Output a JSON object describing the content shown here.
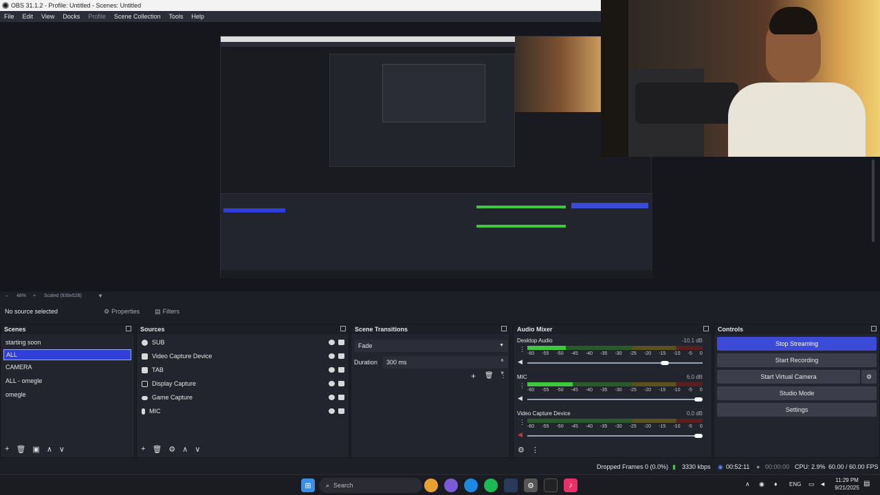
{
  "window": {
    "title": "OBS 31.1.2 - Profile: Untitled - Scenes: Untitled"
  },
  "menu": {
    "items": [
      "File",
      "Edit",
      "View",
      "Docks",
      "Profile",
      "Scene Collection",
      "Tools",
      "Help"
    ]
  },
  "zoom": {
    "percent": "48%",
    "scaled": "Scaled (939x528)"
  },
  "selection": {
    "status": "No source selected",
    "properties_label": "Properties",
    "filters_label": "Filters"
  },
  "scenes": {
    "title": "Scenes",
    "items": [
      "starting soon",
      "ALL",
      "CAMERA",
      "ALL - omegle",
      "omegle"
    ],
    "selected": "ALL"
  },
  "sources": {
    "title": "Sources",
    "items": [
      {
        "label": "SUB",
        "icon": "browser-icon"
      },
      {
        "label": "Video Capture Device",
        "icon": "camera-icon"
      },
      {
        "label": "TAB",
        "icon": "window-icon"
      },
      {
        "label": "Display Capture",
        "icon": "monitor-icon"
      },
      {
        "label": "Game Capture",
        "icon": "gamepad-icon"
      },
      {
        "label": "MIC",
        "icon": "microphone-icon"
      }
    ]
  },
  "transitions": {
    "title": "Scene Transitions",
    "type": "Fade",
    "duration_label": "Duration",
    "duration_value": "300 ms"
  },
  "mixer": {
    "title": "Audio Mixer",
    "tick_labels": [
      "-60",
      "-55",
      "-50",
      "-45",
      "-40",
      "-35",
      "-30",
      "-25",
      "-20",
      "-15",
      "-10",
      "-5",
      "0"
    ],
    "channels": [
      {
        "name": "Desktop Audio",
        "db": "-10.1 dB",
        "level": 0.22,
        "volume": 0.8
      },
      {
        "name": "MIC",
        "db": "6.0 dB",
        "level": 0.26,
        "volume": 1.0
      },
      {
        "name": "Video Capture Device",
        "db": "0.0 dB",
        "level": 0.0,
        "volume": 1.0
      }
    ]
  },
  "controls": {
    "title": "Controls",
    "buttons": [
      "Stop Streaming",
      "Start Recording",
      "Start Virtual Camera",
      "Studio Mode",
      "Settings"
    ]
  },
  "status": {
    "dropped": "Dropped Frames 0 (0.0%)",
    "bitrate": "3330 kbps",
    "stream_time": "00:52:11",
    "rec_time": "00:00:00",
    "cpu": "CPU: 2.9%",
    "fps": "60.00 / 60.00 FPS"
  },
  "taskbar": {
    "search_placeholder": "Search",
    "lang": "ENG",
    "time": "11:29 PM",
    "date": "9/21/2025"
  },
  "colors": {
    "accent": "#3c4ad8",
    "meter_green": "#3ec83e",
    "meter_yellow": "#b8a020",
    "meter_red": "#b02020"
  }
}
